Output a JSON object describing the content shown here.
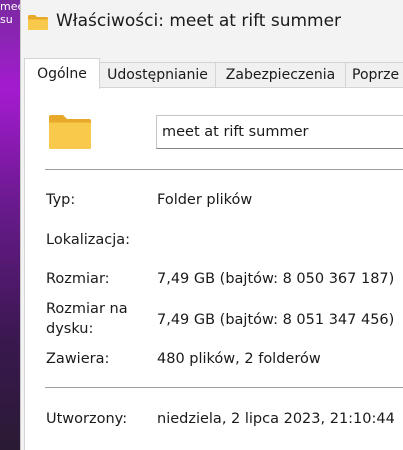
{
  "desktop": {
    "label_line1": "meet at rift",
    "label_line2": "su"
  },
  "window": {
    "title": "Właściwości: meet at rift summer"
  },
  "tabs": [
    {
      "label": "Ogólne",
      "active": true
    },
    {
      "label": "Udostępnianie",
      "active": false
    },
    {
      "label": "Zabezpieczenia",
      "active": false
    },
    {
      "label": "Poprze",
      "active": false
    }
  ],
  "general": {
    "name_value": "meet at rift summer",
    "type_label": "Typ:",
    "type_value": "Folder plików",
    "location_label": "Lokalizacja:",
    "location_value": "",
    "size_label": "Rozmiar:",
    "size_value": "7,49 GB (bajtów: 8 050 367 187)",
    "size_on_disk_label_line1": "Rozmiar na",
    "size_on_disk_label_line2": "dysku:",
    "size_on_disk_value": "7,49 GB (bajtów: 8 051 347 456)",
    "contains_label": "Zawiera:",
    "contains_value": "480 plików, 2 folderów",
    "created_label": "Utworzony:",
    "created_value": "niedziela, 2 lipca 2023, 21:10:44"
  },
  "colors": {
    "folder_yellow": "#f8c94a",
    "folder_dark": "#e8a92a",
    "desktop_purple": "#a41bd0"
  },
  "icons": {
    "title_icon": "folder-icon",
    "large_icon": "folder-icon"
  }
}
